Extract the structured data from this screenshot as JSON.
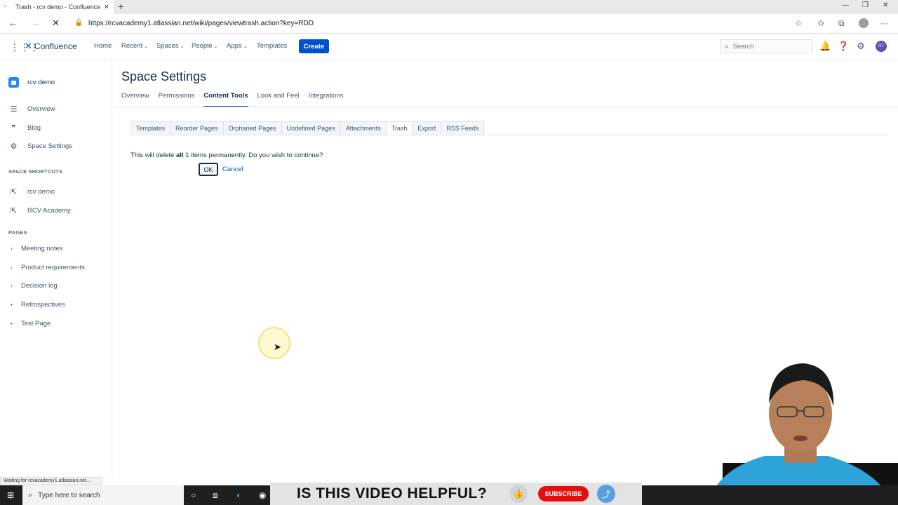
{
  "browser": {
    "tab_title": "Trash - rcv demo - Confluence",
    "url": "https://rcvacademy1.atlassian.net/wiki/pages/viewtrash.action?key=RDD",
    "status": "Waiting for rcvacademy1.atlassian.net..."
  },
  "topnav": {
    "logo": "Confluence",
    "items": [
      "Home",
      "Recent",
      "Spaces",
      "People",
      "Apps",
      "Templates"
    ],
    "create": "Create",
    "search_placeholder": "Search",
    "user_initials": "RT"
  },
  "sidebar": {
    "space_name": "rcv demo",
    "items": [
      "Overview",
      "Blog",
      "Space Settings"
    ],
    "shortcuts_heading": "SPACE SHORTCUTS",
    "shortcuts": [
      "rcv demo",
      "RCV Academy"
    ],
    "pages_heading": "PAGES",
    "pages": [
      "Meeting notes",
      "Product requirements",
      "Decision log",
      "Retrospectives",
      "Test Page"
    ]
  },
  "main": {
    "title": "Space Settings",
    "tabs": [
      "Overview",
      "Permissions",
      "Content Tools",
      "Look and Feel",
      "Integrations"
    ],
    "active_tab": "Content Tools",
    "content_tabs": [
      "Templates",
      "Reorder Pages",
      "Orphaned Pages",
      "Undefined Pages",
      "Attachments",
      "Trash",
      "Export",
      "RSS Feeds"
    ],
    "active_content_tab": "Trash",
    "message_pre": "This will delete ",
    "message_bold": "all",
    "message_post": " 1 items permanently. Do you wish to continue?",
    "ok": "OK",
    "cancel": "Cancel"
  },
  "taskbar": {
    "search_placeholder": "Type here to search"
  },
  "overlay": {
    "question": "IS THIS VIDEO HELPFUL?",
    "subscribe": "SUBSCRIBE"
  },
  "colors": {
    "brand": "#0052cc",
    "subscribe": "#e01010"
  }
}
